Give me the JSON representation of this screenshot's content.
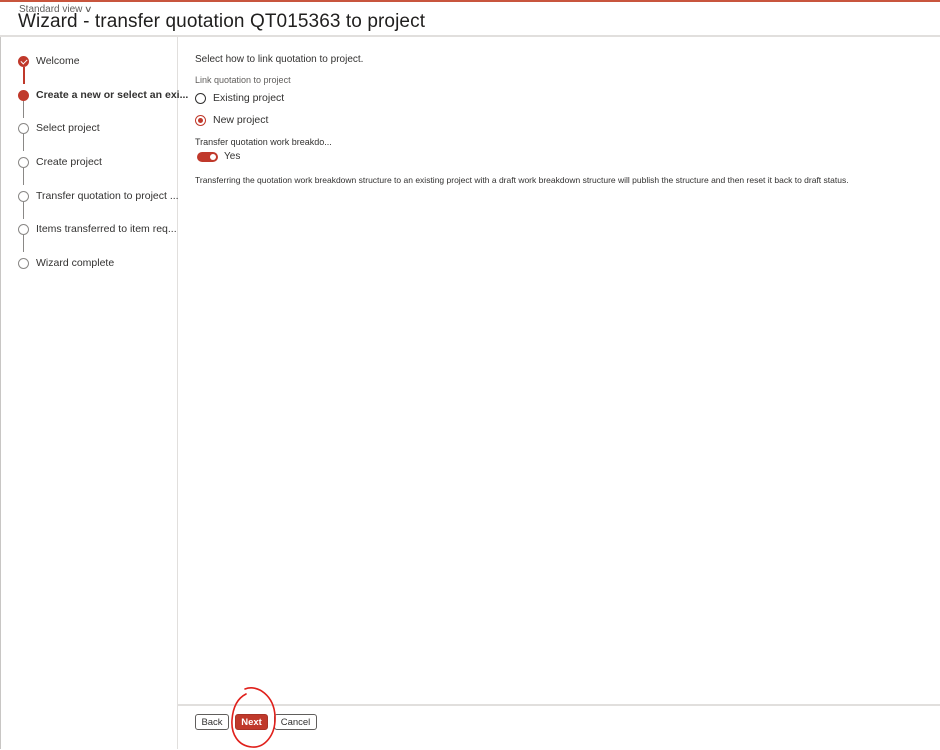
{
  "header": {
    "view_selector": "Standard view",
    "title": "Wizard - transfer quotation QT015363 to project"
  },
  "steps": [
    {
      "label": "Welcome",
      "state": "done"
    },
    {
      "label": "Create a new or select an exi...",
      "state": "current"
    },
    {
      "label": "Select project",
      "state": "pending"
    },
    {
      "label": "Create project",
      "state": "pending"
    },
    {
      "label": "Transfer quotation to project ...",
      "state": "pending"
    },
    {
      "label": "Items transferred to item req...",
      "state": "pending"
    },
    {
      "label": "Wizard complete",
      "state": "pending"
    }
  ],
  "main": {
    "intro": "Select how to link quotation to project.",
    "link_label": "Link quotation to project",
    "options": [
      {
        "label": "Existing project",
        "checked": false
      },
      {
        "label": "New project",
        "checked": true
      }
    ],
    "toggle_label": "Transfer quotation work breakdo...",
    "toggle_value": "Yes",
    "toggle_on": true,
    "note": "Transferring the quotation work breakdown structure to an existing project with a draft work breakdown structure will publish the structure and then reset it back to draft status."
  },
  "footer": {
    "back_label": "Back",
    "next_label": "Next",
    "cancel_label": "Cancel"
  },
  "colors": {
    "accent": "#c0392b",
    "topbar": "#c8553d",
    "annotation": "#e0201b"
  }
}
